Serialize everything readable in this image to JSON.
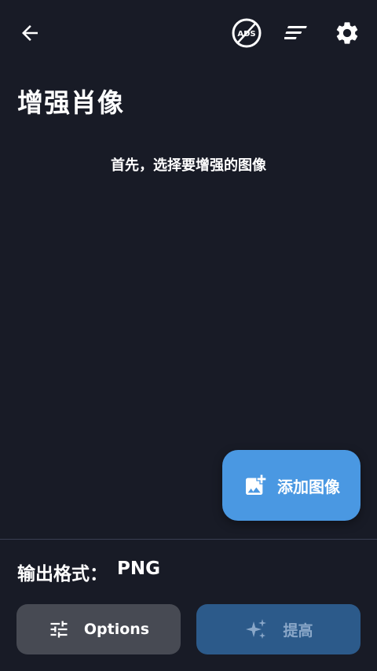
{
  "appbar": {
    "back_icon": "arrow-left-icon",
    "ads_icon": "ads-off-icon",
    "ads_icon_text": "ADS",
    "sort_icon": "sort-lines-icon",
    "settings_icon": "gear-icon"
  },
  "page": {
    "title": "增强肖像",
    "hint": "首先，选择要增强的图像"
  },
  "fab": {
    "label": "添加图像",
    "icon": "add-photo-icon",
    "color": "#4a98e2"
  },
  "output": {
    "label": "输出格式：",
    "value": "PNG"
  },
  "actions": {
    "options_label": "Options",
    "options_icon": "sliders-icon",
    "enhance_label": "提高",
    "enhance_icon": "sparkles-icon",
    "enhance_color": "#2c5a8a"
  },
  "colors": {
    "background": "#181b26",
    "options_bg": "#474a53"
  }
}
